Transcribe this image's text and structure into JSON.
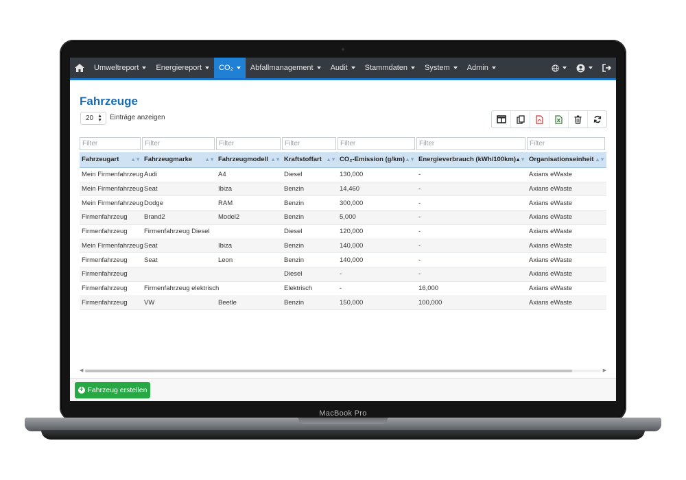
{
  "device": {
    "label": "MacBook Pro"
  },
  "navbar": {
    "home_icon": "home-icon",
    "items": [
      {
        "label": "Umweltreport",
        "active": false
      },
      {
        "label": "Energiereport",
        "active": false
      },
      {
        "label": "CO₂",
        "active": true
      },
      {
        "label": "Abfallmanagement",
        "active": false
      },
      {
        "label": "Audit",
        "active": false
      },
      {
        "label": "Stammdaten",
        "active": false
      },
      {
        "label": "System",
        "active": false
      },
      {
        "label": "Admin",
        "active": false
      }
    ],
    "right_icons": [
      "globe-icon",
      "user-icon",
      "logout-icon"
    ],
    "active_color": "#1f80d4",
    "accent_color": "#1a73c7"
  },
  "page": {
    "title": "Fahrzeuge",
    "length_value": "20",
    "length_label": "Einträge anzeigen"
  },
  "toolbar": {
    "buttons": [
      "columns-icon",
      "copy-icon",
      "pdf-icon",
      "excel-icon",
      "trash-icon",
      "refresh-icon"
    ]
  },
  "table": {
    "filter_placeholder": "Filter",
    "columns": [
      "Fahrzeugart",
      "Fahrzeugmarke",
      "Fahrzeugmodell",
      "Kraftstoffart",
      "CO₂-Emission (g/km)",
      "Energieverbrauch (kWh/100km)",
      "Organisationseinheit"
    ],
    "sorted_column": 5,
    "sort_direction": "asc",
    "rows": [
      [
        "Mein Firmenfahrzeug",
        "Audi",
        "A4",
        "Diesel",
        "130,000",
        "-",
        "Axians eWaste"
      ],
      [
        "Mein Firmenfahrzeug",
        "Seat",
        "Ibiza",
        "Benzin",
        "14,460",
        "-",
        "Axians eWaste"
      ],
      [
        "Mein Firmenfahrzeug",
        "Dodge",
        "RAM",
        "Benzin",
        "300,000",
        "-",
        "Axians eWaste"
      ],
      [
        "Firmenfahrzeug",
        "Brand2",
        "Model2",
        "Benzin",
        "5,000",
        "-",
        "Axians eWaste"
      ],
      [
        "Firmenfahrzeug",
        "Firmenfahrzeug Diesel",
        "",
        "Diesel",
        "120,000",
        "-",
        "Axians eWaste"
      ],
      [
        "Mein Firmenfahrzeug",
        "Seat",
        "Ibiza",
        "Benzin",
        "140,000",
        "-",
        "Axians eWaste"
      ],
      [
        "Firmenfahrzeug",
        "Seat",
        "Leon",
        "Benzin",
        "140,000",
        "-",
        "Axians eWaste"
      ],
      [
        "Firmenfahrzeug",
        "",
        "",
        "Diesel",
        "-",
        "-",
        "Axians eWaste"
      ],
      [
        "Firmenfahrzeug",
        "Firmenfahrzeug elektrisch",
        "",
        "Elektrisch",
        "-",
        "16,000",
        "Axians eWaste"
      ],
      [
        "Firmenfahrzeug",
        "VW",
        "Beetle",
        "Benzin",
        "150,000",
        "100,000",
        "Axians eWaste"
      ]
    ]
  },
  "footer": {
    "create_label": "Fahrzeug erstellen",
    "create_color": "#28a745"
  }
}
